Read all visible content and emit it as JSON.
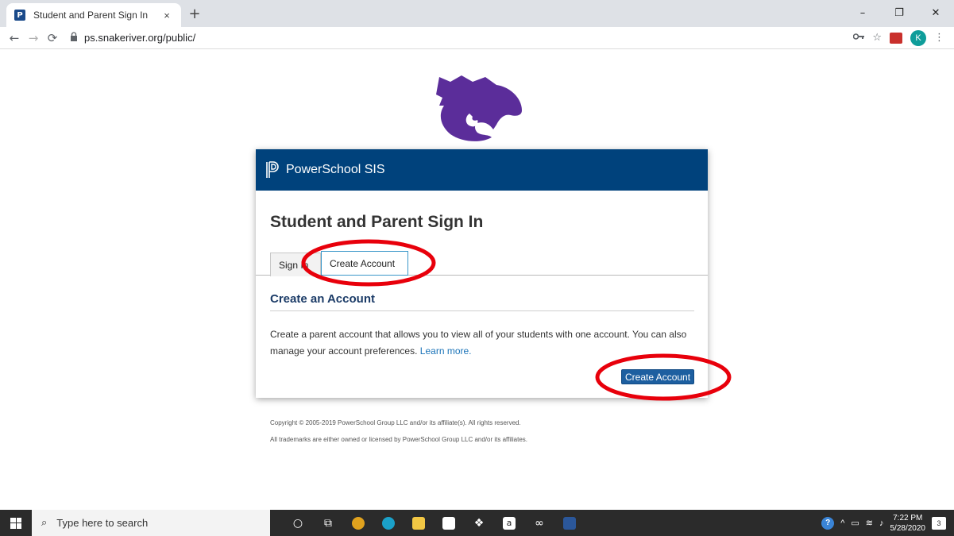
{
  "browser": {
    "tab_title": "Student and Parent Sign In",
    "tab_close_glyph": "×",
    "new_tab_glyph": "+",
    "url": "ps.snakeriver.org/public/",
    "profile_initial": "K",
    "window_controls": {
      "minimize": "–",
      "restore": "❐",
      "close": "✕"
    }
  },
  "app": {
    "brand": "PowerSchool SIS",
    "header_color": "#00427c",
    "page_title": "Student and Parent Sign In",
    "tabs": [
      {
        "label": "Sign In",
        "active": false
      },
      {
        "label": "Create Account",
        "active": true
      }
    ],
    "section_title": "Create an Account",
    "description": "Create a parent account that allows you to view all of your students with one account. You can also manage your account preferences.",
    "learn_more": "Learn more.",
    "create_button": "Create Account"
  },
  "footer": {
    "copyright": "Copyright © 2005-2019 PowerSchool Group LLC and/or its affiliate(s). All rights reserved.",
    "trademarks": "All trademarks are either owned or licensed by PowerSchool Group LLC and/or its affiliates."
  },
  "taskbar": {
    "search_placeholder": "Type here to search",
    "time": "7:22 PM",
    "date": "5/28/2020",
    "notification_count": "3"
  },
  "icons": {
    "logo": "wildcat-logo",
    "annotation_color": "#e8000b"
  }
}
